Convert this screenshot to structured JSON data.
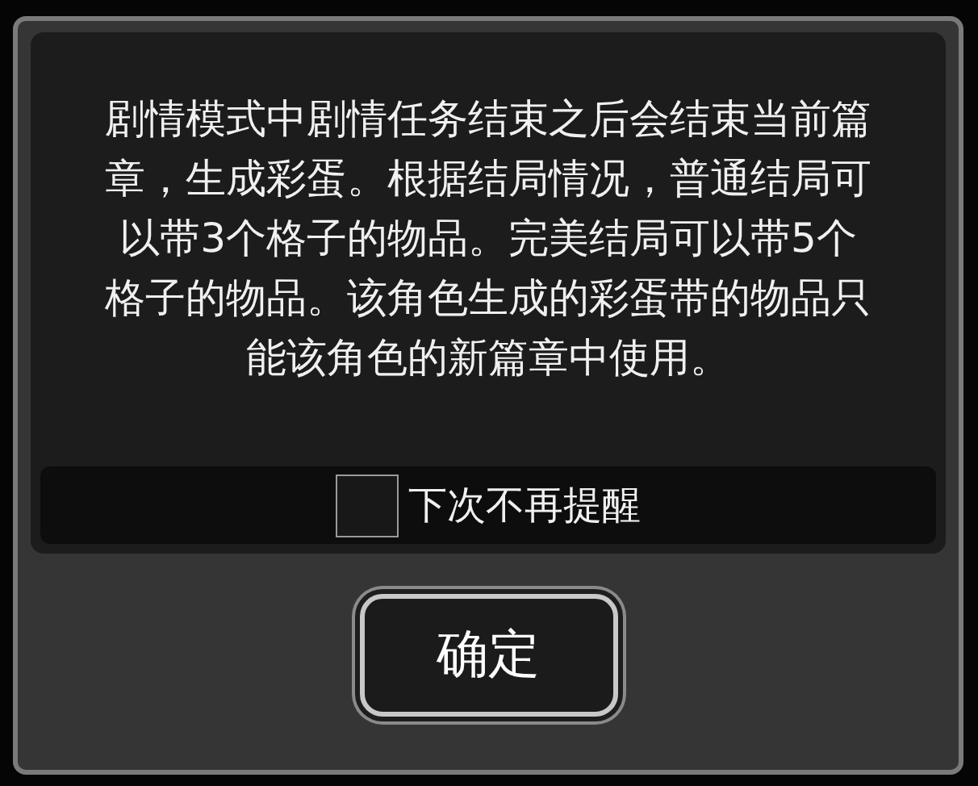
{
  "dialog": {
    "message": "剧情模式中剧情任务结束之后会结束当前篇章，生成彩蛋。根据结局情况，普通结局可以带3个格子的物品。完美结局可以带5个格子的物品。该角色生成的彩蛋带的物品只能该角色的新篇章中使用。",
    "dont_remind": {
      "label": "下次不再提醒",
      "checked": false
    },
    "confirm_button": "确定"
  }
}
